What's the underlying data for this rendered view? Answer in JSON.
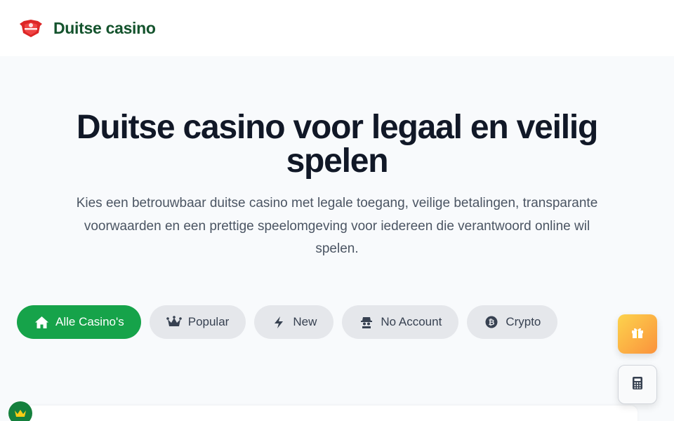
{
  "header": {
    "brand": "Duitse casino",
    "logo_icon": "shield-logo-icon"
  },
  "hero": {
    "title": "Duitse casino voor legaal en veilig spelen",
    "subtitle": "Kies een betrouwbaar duitse casino met legale toegang, veilige betalingen, transparante voorwaarden en een prettige speelomgeving voor iedereen die verantwoord online wil spelen."
  },
  "filters": [
    {
      "label": "Alle Casino's",
      "icon": "home-icon",
      "active": true
    },
    {
      "label": "Popular",
      "icon": "crown-icon",
      "active": false
    },
    {
      "label": "New",
      "icon": "bolt-icon",
      "active": false
    },
    {
      "label": "No Account",
      "icon": "spy-icon",
      "active": false
    },
    {
      "label": "Crypto",
      "icon": "bitcoin-icon",
      "active": false
    }
  ],
  "floating": {
    "gift_icon": "gift-icon",
    "calculator_icon": "calculator-icon"
  },
  "colors": {
    "brand_green": "#14532d",
    "active_chip": "#16a34a",
    "chip_bg": "#e5e7eb",
    "page_bg": "#f8fafc",
    "gift_gradient_start": "#fcd34d",
    "gift_gradient_end": "#fb923c"
  }
}
